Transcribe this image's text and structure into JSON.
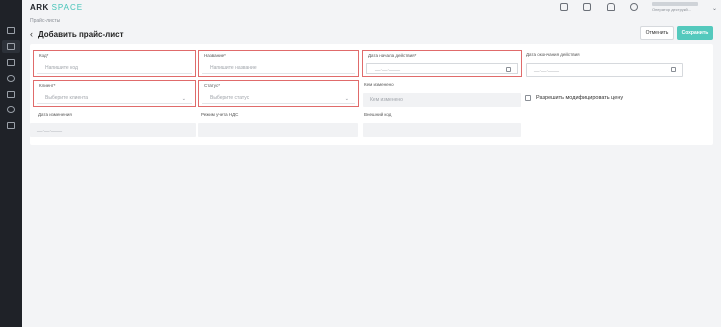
{
  "app": {
    "logo_main": "ARK",
    "logo_accent": "SPACE"
  },
  "header": {
    "user_role": "Оператор деструкй..."
  },
  "breadcrumb": "Прайс-листы",
  "page": {
    "title": "Добавить прайс-лист",
    "cancel_label": "Отменить",
    "save_label": "Сохранить"
  },
  "form": {
    "code": {
      "label": "Код*",
      "placeholder": "Напишите код"
    },
    "name": {
      "label": "Название*",
      "placeholder": "Напишите название"
    },
    "start_date": {
      "label": "Дата начала действия*",
      "placeholder": "__.__.____"
    },
    "end_date": {
      "label": "Дата окончания действия",
      "placeholder": "__.__.____"
    },
    "client": {
      "label": "Клиент*",
      "placeholder": "Выберите клиента"
    },
    "status": {
      "label": "Статус*",
      "placeholder": "Выберите статус"
    },
    "changed_by": {
      "label": "Кем изменено",
      "placeholder": "Кем изменено"
    },
    "allow_price_edit": {
      "label": "Разрешить модифицировать цену"
    },
    "change_date": {
      "label": "Дата изменения",
      "placeholder": "__.__.____"
    },
    "vat_mode": {
      "label": "Режим учета НДС",
      "placeholder": ""
    },
    "external_code": {
      "label": "Внешний код",
      "placeholder": ""
    }
  },
  "colors": {
    "accent": "#54c9bd",
    "error_border": "#e06b6b",
    "sidebar": "#1f2228"
  },
  "icons": {
    "sidebar": [
      "grid-icon",
      "list-icon",
      "table-icon",
      "clock-icon",
      "chart-icon",
      "settings-icon",
      "document-icon"
    ],
    "top": [
      "chat-icon",
      "apps-icon",
      "bell-icon",
      "compass-icon"
    ]
  }
}
